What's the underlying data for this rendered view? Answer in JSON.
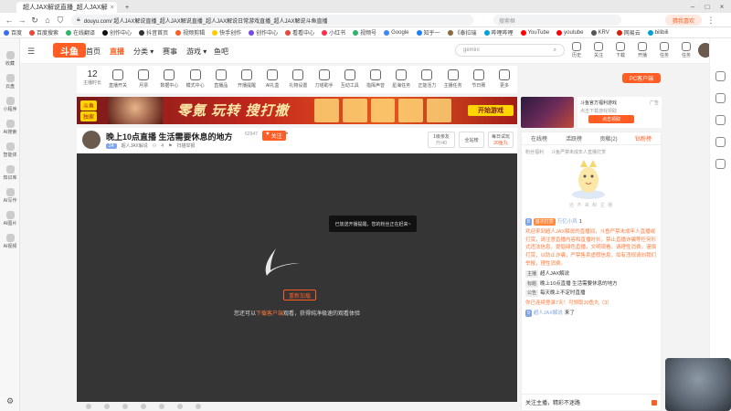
{
  "browser": {
    "tabs": [
      {
        "label": "超人JAX解说直播_超人JAX解",
        "active": true
      },
      {
        "label": "",
        "active": false
      }
    ],
    "url": "douyu.com/ 超人JAX解说直播_超人JAX解说直播_超人JAX解说日常游戏直播_超人JAX解说斗鱼直播",
    "top_right_search_placeholder": "搜索框",
    "top_right_button": "猜我喜欢",
    "bookmarks": [
      "百度",
      "百度搜索",
      "在线翻译",
      "创作中心",
      "抖音首页",
      "视频剪辑",
      "快手创作",
      "创作中心",
      "看看中心",
      "小红书",
      "视频号",
      "Google",
      "知乎一",
      "《泰拉瑞",
      "哔哩哔哩",
      "YouTube",
      "youtube",
      "KRV",
      "网易云",
      "bilibili"
    ],
    "bookmark_colors": [
      "#3b6ee8",
      "#e24a3b",
      "#2fb56a",
      "#111111",
      "#333333",
      "#ff5d23",
      "#ffcc00",
      "#7a4ae0",
      "#e24a3b",
      "#ff2e4d",
      "#2fb56a",
      "#4285f4",
      "#1e80ff",
      "#8c6a3a",
      "#00a1d6",
      "#ff0000",
      "#ff0000",
      "#555555",
      "#d81e06",
      "#00a1d6"
    ]
  },
  "left_sidebar": {
    "items": [
      "收藏",
      "云盘",
      "小程序",
      "AI搜索",
      "智能体",
      "知识库",
      "AI写作",
      "AI图片",
      "AI视频"
    ]
  },
  "site": {
    "logo": "斗鱼",
    "nav": [
      {
        "label": "首页",
        "active": false
      },
      {
        "label": "直播",
        "active": true
      },
      {
        "label": "分类",
        "active": false
      },
      {
        "label": "赛事",
        "active": false
      },
      {
        "label": "游戏",
        "active": false
      },
      {
        "label": "鱼吧",
        "active": false
      }
    ],
    "search_placeholder": "gemini",
    "top_right": [
      "历史",
      "关注",
      "下载",
      "开播",
      "任务",
      "任务"
    ],
    "pc_button": "PC客户端"
  },
  "category_bar": {
    "hours": "12",
    "hours_label": "主播时长",
    "items": [
      "直播开关",
      "月票",
      "数据中心",
      "模式中心",
      "直播品",
      "开播提醒",
      "AI礼盒",
      "礼物设置",
      "刀塔助手",
      "互动工具",
      "指挥声音",
      "星海任务",
      "正能活力",
      "主播任务",
      "节日赛",
      "更多"
    ]
  },
  "banner": {
    "left_badge1": "斗鱼",
    "left_badge2": "独家",
    "title": "零氪 玩转 搜打撤",
    "button": "开始游戏"
  },
  "ad": {
    "title": "斗鱼官方福利游戏",
    "tag": "广告",
    "desc": "点击下载游戏领取",
    "button": "点击领取"
  },
  "room": {
    "title": "晚上10点直播 生活需要休息的地方",
    "room_id": "62947",
    "follow_label": "关注",
    "level": "24",
    "streamer": "超人JAX解说",
    "fans": "4",
    "report": "扫描举报",
    "box1_top": "1级亲友",
    "box1_bottom": "升/40",
    "box2": "全站榜",
    "box3_top": "每日试玩",
    "box3_bottom": "20鱼丸"
  },
  "player": {
    "toast": "已放送开播提醒，您的粉丝正在赶来~",
    "retry": "重新加载",
    "tip_pre": "您还可以",
    "tip_link": "下载客户端",
    "tip_post": "观看，获得纯净极速的观看体验"
  },
  "right_panel": {
    "tabs": [
      {
        "label": "在线榜",
        "active": false
      },
      {
        "label": "活跃榜",
        "active": false
      },
      {
        "label": "贡献(2)",
        "active": false
      },
      {
        "label": "钻粉榜",
        "active": true
      }
    ],
    "notice1": "粉丝福利",
    "notice2": "斗鱼严禁未成年人直播打赏",
    "mascot_caption": "还 不 来 和 主 播",
    "chat": [
      {
        "lv": "8",
        "badge": "首次打赏",
        "user": "万亿小风",
        "text": "1"
      },
      {
        "text": "欢迎来到超人JAX解说的直播间，斗鱼严禁未成年人直播或打赏，请注意直播内容和直播时长，禁止直播诈骗等任何形式违法信息，提倡绿色直播，文明观看。请理性消费，谨慎打赏，以防止诈骗，严禁售卖虚假信息，如有违规请向我们举报，理性消费。"
      },
      {
        "tag": "主播",
        "text": "超人JAX解说"
      },
      {
        "tag": "标题",
        "text": "晚上10点直播 生活需要休息的地方"
      },
      {
        "tag": "公告",
        "text": "每天晚上不定时直播"
      },
      {
        "text": "你已连续登录7天！可领取30鱼丸（3）"
      },
      {
        "lv": "9",
        "user": "超人JAX解说",
        "text": "来了"
      }
    ],
    "follow_text": "关注主播，精彩不迷路"
  },
  "right_sidebar": {
    "items": [
      "收藏",
      "历史",
      "设置",
      "工具",
      "帮助"
    ]
  }
}
